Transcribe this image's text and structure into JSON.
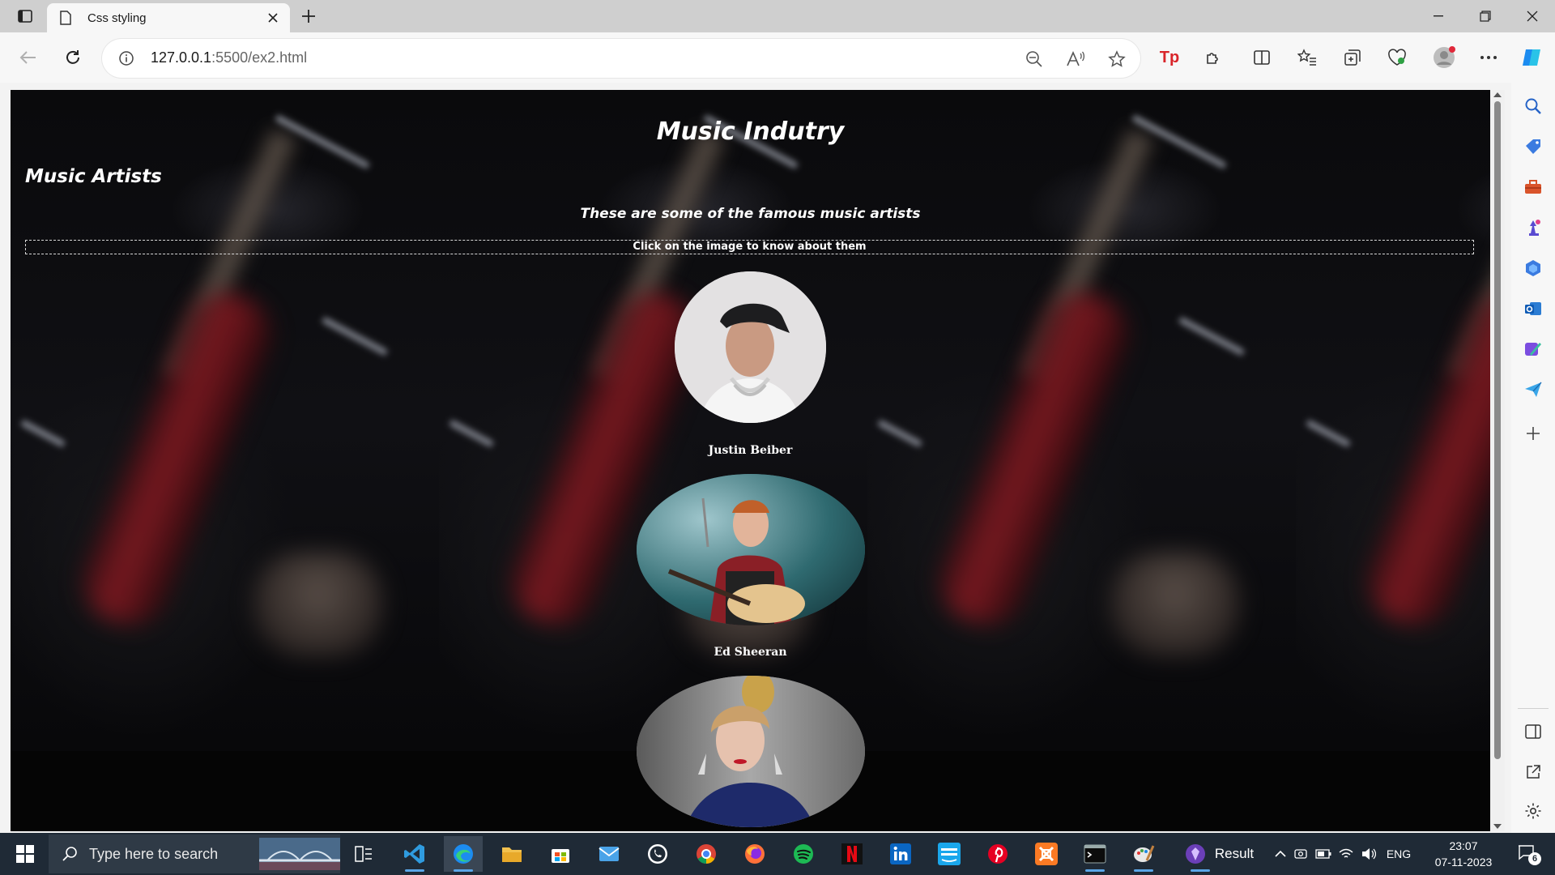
{
  "browser": {
    "tab_title": "Css styling",
    "url_host": "127.0.0.1",
    "url_rest": ":5500/ex2.html"
  },
  "page": {
    "heading": "Music Indutry",
    "section_title": "Music Artists",
    "subtitle": "These are some of the famous music artists",
    "hint": "Click on the image to know about them",
    "artists": [
      {
        "name": "Justin Beiber"
      },
      {
        "name": "Ed Sheeran"
      }
    ]
  },
  "taskbar": {
    "search_placeholder": "Type here to search",
    "result_label": "Result",
    "language": "ENG",
    "time": "23:07",
    "date": "07-11-2023",
    "notification_count": "6"
  }
}
